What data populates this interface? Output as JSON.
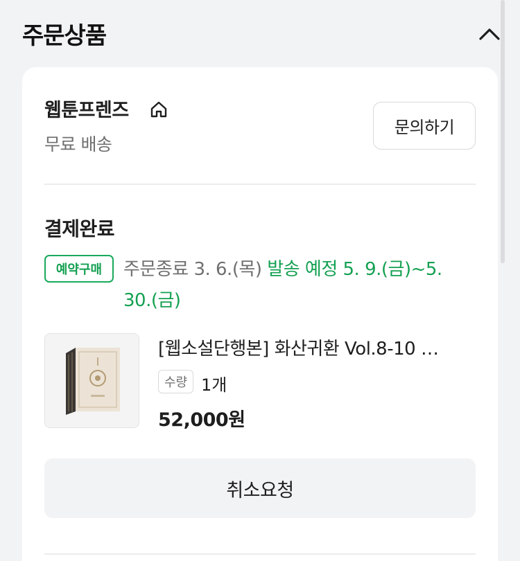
{
  "header": {
    "title": "주문상품",
    "collapse_icon": "chevron-up-icon"
  },
  "seller": {
    "name": "웹툰프렌즈",
    "home_icon": "home-icon",
    "shipping": "무료 배송",
    "inquiry_label": "문의하기"
  },
  "order": {
    "status": "결제완료",
    "badge": "예약구매",
    "order_end": "주문종료 3. 6.(목) ",
    "ship_schedule": "발송 예정 5. 9.(금)~5. 30.(금)"
  },
  "product": {
    "name": "[웹소설단행본] 화산귀환 Vol.8-10 …",
    "quantity_label": "수량",
    "quantity_value": "1개",
    "price": "52,000원"
  },
  "actions": {
    "cancel_label": "취소요청"
  },
  "colors": {
    "accent_green": "#14a052",
    "background": "#f2f3f5",
    "card": "#ffffff"
  }
}
